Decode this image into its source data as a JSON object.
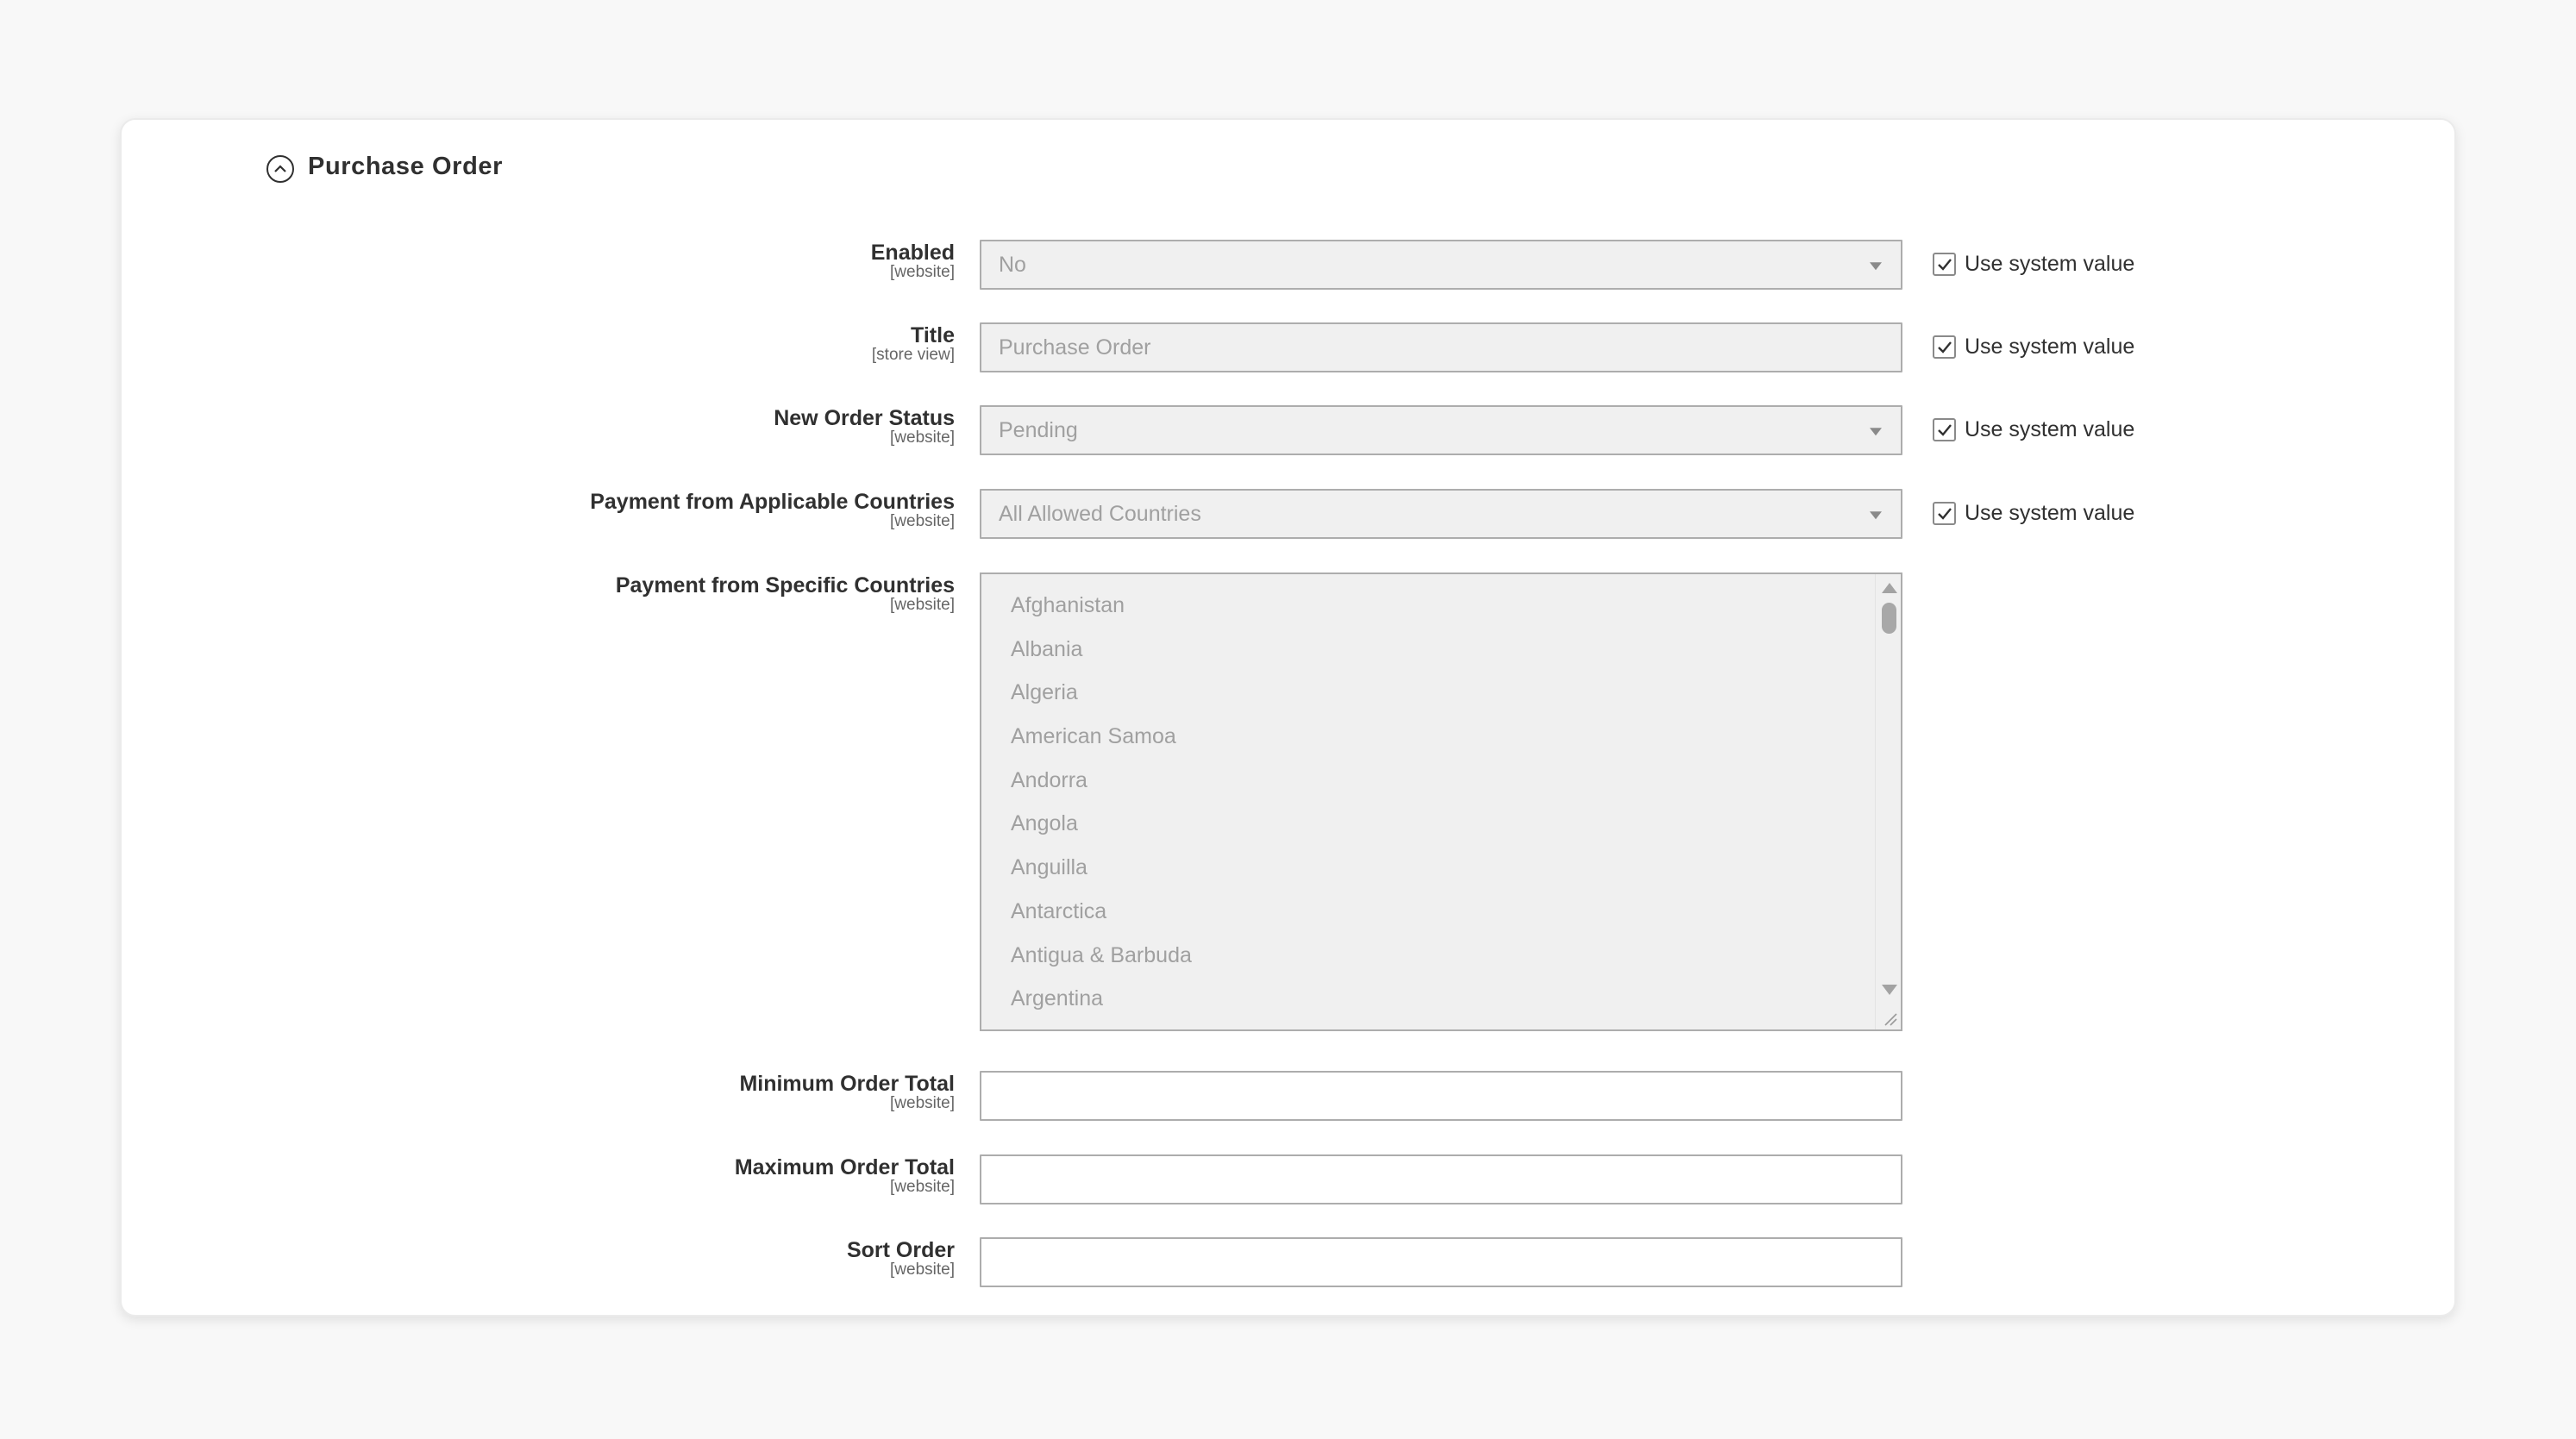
{
  "section": {
    "title": "Purchase Order",
    "collapse_icon": "chevron-up-circle-icon"
  },
  "system_value_label": "Use system value",
  "fields": {
    "enabled": {
      "label": "Enabled",
      "scope": "[website]",
      "value": "No",
      "use_system_value": true
    },
    "title": {
      "label": "Title",
      "scope": "[store view]",
      "value": "Purchase Order",
      "use_system_value": true
    },
    "new_order_status": {
      "label": "New Order Status",
      "scope": "[website]",
      "value": "Pending",
      "use_system_value": true
    },
    "applicable_countries": {
      "label": "Payment from Applicable Countries",
      "scope": "[website]",
      "value": "All Allowed Countries",
      "use_system_value": true
    },
    "specific_countries": {
      "label": "Payment from Specific Countries",
      "scope": "[website]",
      "options": [
        "Afghanistan",
        "Albania",
        "Algeria",
        "American Samoa",
        "Andorra",
        "Angola",
        "Anguilla",
        "Antarctica",
        "Antigua & Barbuda",
        "Argentina"
      ]
    },
    "min_order_total": {
      "label": "Minimum Order Total",
      "scope": "[website]",
      "value": ""
    },
    "max_order_total": {
      "label": "Maximum Order Total",
      "scope": "[website]",
      "value": ""
    },
    "sort_order": {
      "label": "Sort Order",
      "scope": "[website]",
      "value": ""
    }
  }
}
